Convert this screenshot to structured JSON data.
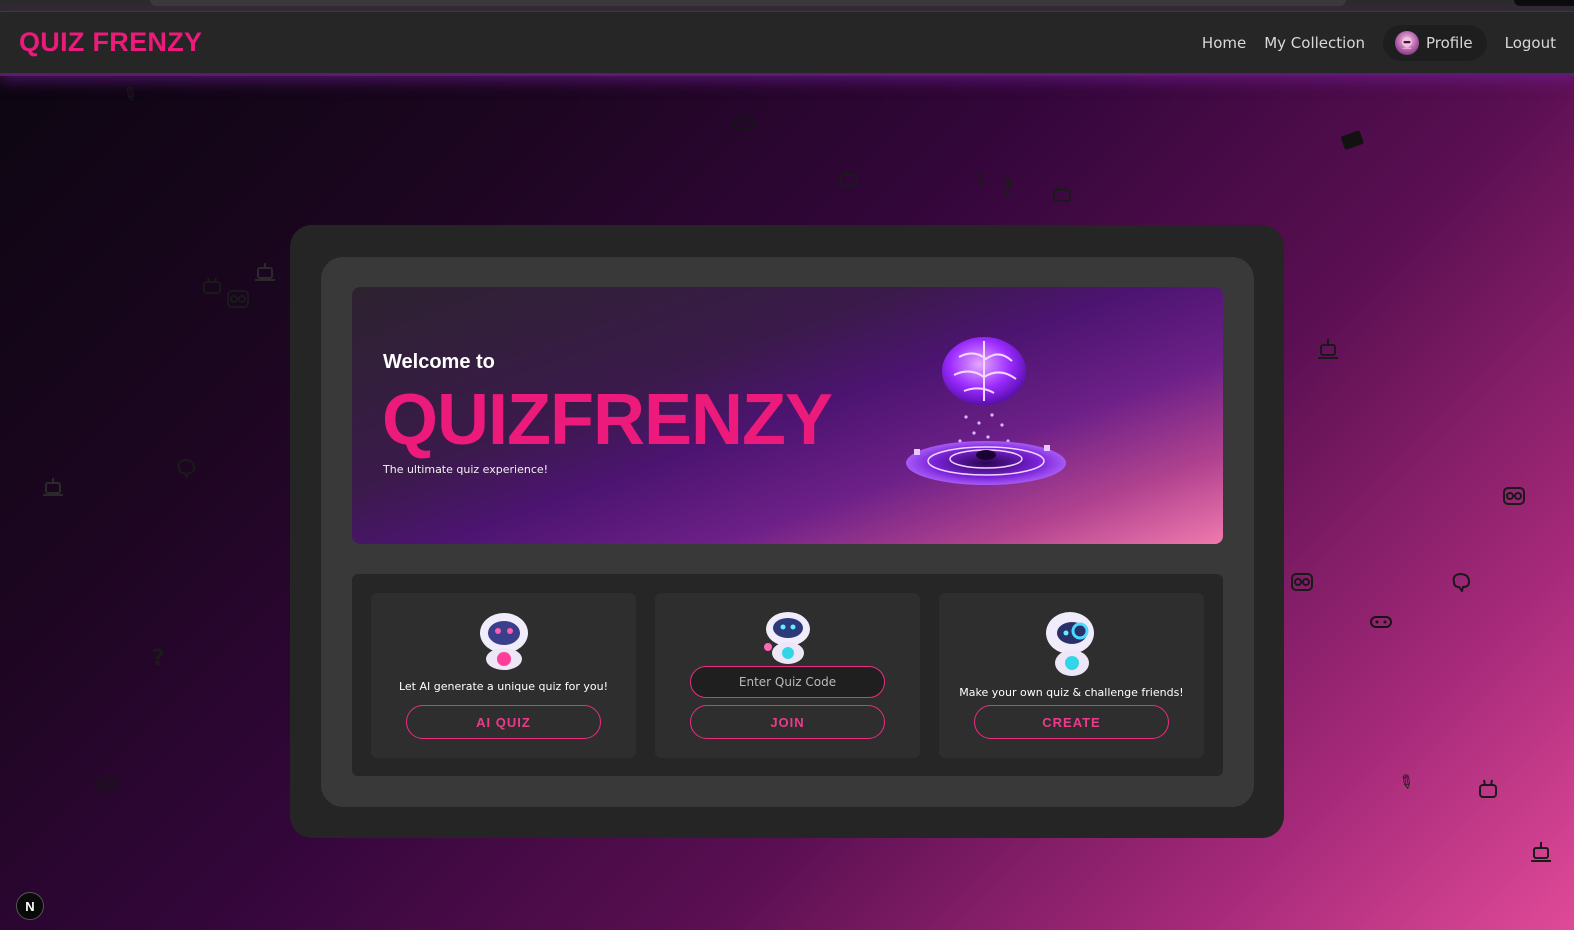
{
  "navbar": {
    "brand": "QUIZ FRENZY",
    "links": {
      "home": "Home",
      "collection": "My Collection",
      "profile": "Profile",
      "logout": "Logout"
    }
  },
  "hero": {
    "welcome": "Welcome to",
    "title": "QUIZFRENZY",
    "subtitle": "The ultimate quiz experience!",
    "art_icon": "brain-hologram-icon"
  },
  "actions": {
    "ai": {
      "text": "Let AI generate a unique quiz for you!",
      "button": "AI QUIZ",
      "icon": "robot-mascot-icon"
    },
    "join": {
      "placeholder": "Enter Quiz Code",
      "button": "JOIN",
      "icon": "robot-mascot-icon"
    },
    "create": {
      "text": "Make your own quiz & challenge friends!",
      "button": "CREATE",
      "icon": "robot-mascot-icon"
    }
  },
  "badge": {
    "label": "N"
  },
  "colors": {
    "brand_pink": "#ec1a7a",
    "nav_bg": "#262626",
    "card_bg": "#252525",
    "inner_bg": "#393939"
  }
}
